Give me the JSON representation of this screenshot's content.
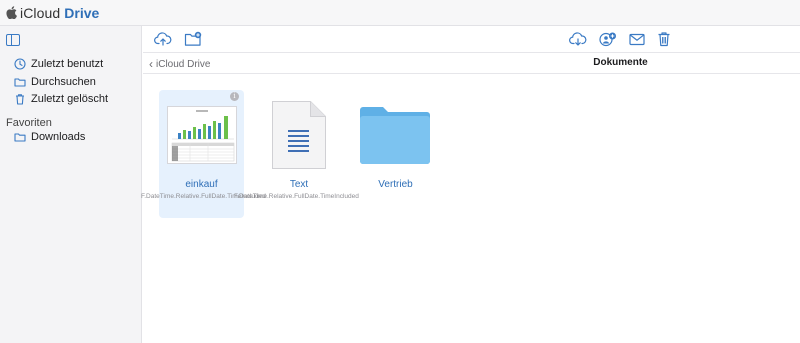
{
  "app": {
    "brand_icloud": "iCloud",
    "brand_drive": "Drive",
    "accent_color": "#2f6fb7",
    "folder_color": "#7cc3f0"
  },
  "sidebar": {
    "items": [
      {
        "label": "Zuletzt benutzt",
        "icon": "clock-icon"
      },
      {
        "label": "Durchsuchen",
        "icon": "folder-icon"
      },
      {
        "label": "Zuletzt gelöscht",
        "icon": "trash-icon"
      }
    ],
    "favorites_title": "Favoriten",
    "favorites": [
      {
        "label": "Downloads",
        "icon": "folder-icon"
      }
    ]
  },
  "toolbar": {
    "left": [
      "upload-icon",
      "new-folder-icon"
    ],
    "right": [
      "download-icon",
      "share-people-icon",
      "mail-icon",
      "trash-icon"
    ]
  },
  "pathbar": {
    "back_label": "iCloud Drive",
    "title": "Dokumente"
  },
  "files": [
    {
      "name": "einkauf",
      "meta": "F.DateTime.Relative.FullDate.TimeIncluded",
      "kind": "spreadsheet",
      "selected": true
    },
    {
      "name": "Text",
      "meta": "F.DateTime.Relative.FullDate.TimeIncluded",
      "kind": "document",
      "selected": false
    },
    {
      "name": "Vertrieb",
      "meta": "",
      "kind": "folder",
      "selected": false
    }
  ]
}
